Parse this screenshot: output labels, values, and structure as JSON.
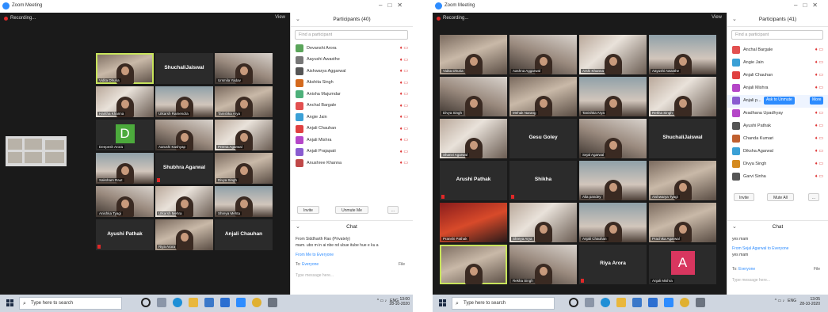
{
  "left": {
    "title": "Zoom Meeting",
    "recording": "Recording...",
    "view_label": "View",
    "panel_title": "Participants (40)",
    "search_placeholder": "Find a participant",
    "participants": [
      {
        "name": "Devanshi Arora",
        "color": "#5aa55a"
      },
      {
        "name": "Aayushi Awasthe",
        "color": "#777"
      },
      {
        "name": "Aishwarya Aggarwal",
        "color": "#555"
      },
      {
        "name": "Akshita Singh",
        "color": "#d46a1e"
      },
      {
        "name": "Anisha Majumdar",
        "color": "#4db07a"
      },
      {
        "name": "Anchal Bargale",
        "color": "#e25050"
      },
      {
        "name": "Angie Jain",
        "color": "#3aa0d6"
      },
      {
        "name": "Anjali Chauhan",
        "color": "#e04040"
      },
      {
        "name": "Anjali Mishra",
        "color": "#b546c8"
      },
      {
        "name": "Anjali Prajapati",
        "color": "#8a5cd0"
      },
      {
        "name": "Anushree Khanna",
        "color": "#c04848"
      }
    ],
    "btn_invite": "Invite",
    "btn_unmute": "Unmute Me",
    "btn_more": "...",
    "chat_title": "Chat",
    "chat_line1": "From Siddharth Rao  (Privately)",
    "chat_line2": "mam. ubo m in ai nbe nd ubue itube hue e ku a",
    "chat_from": "From Me to Everyone",
    "to_label": "To:",
    "to_value": "Everyone",
    "file_label": "File",
    "chat_placeholder": "Type message here...",
    "tiles": [
      {
        "label": "Vidita Dhuria"
      },
      {
        "label": "Utkarsh Mehra"
      },
      {
        "label": "Ursmila Yadav"
      },
      {
        "label": "Tanishka Arya"
      },
      {
        "label": "Deepesh Arora"
      },
      {
        "label": "Aarushi Kashyap"
      },
      {
        "label": "Prerna Agarwal"
      },
      {
        "label": "Saksham Raut"
      },
      {
        "label": "Divya Singh"
      },
      {
        "label": "Haritha Khanna"
      },
      {
        "label": "Anishka Tyagi"
      },
      {
        "label": "Shreya Mehta"
      },
      {
        "label": "Riya Arora"
      }
    ],
    "names": {
      "a": "Utkarsh Ramendra",
      "c": "ShuchaliJaiswal",
      "d": "Shubhra Agarwal",
      "e": "Ayushi Pathak",
      "f": "Anjali Chauhan"
    },
    "avatar_letter": "D",
    "taskbar_search": "Type here to search",
    "tray_time": "13:00",
    "tray_date": "28-10-2020",
    "tray_lang": "ENG"
  },
  "right": {
    "title": "Zoom Meeting",
    "recording": "Recording...",
    "view_label": "View",
    "panel_title": "Participants (41)",
    "search_placeholder": "Find a participant",
    "participants": [
      {
        "name": "Anchal Bargale",
        "color": "#e25050"
      },
      {
        "name": "Angie Jain",
        "color": "#3aa0d6"
      },
      {
        "name": "Anjali Chauhan",
        "color": "#e04040"
      },
      {
        "name": "Anjali Mishra",
        "color": "#b546c8"
      },
      {
        "name": "Anjali p...",
        "color": "#8a5cd0"
      },
      {
        "name": "Aradhana Upadhyay",
        "color": "#b546c8"
      },
      {
        "name": "Ayushi Pathak",
        "color": "#555"
      },
      {
        "name": "Chanda Kumari",
        "color": "#c06030"
      },
      {
        "name": "Diksha Agarwal",
        "color": "#3aa0d6"
      },
      {
        "name": "Divya Singh",
        "color": "#d48a1e"
      },
      {
        "name": "Garvi Sinha",
        "color": "#555"
      }
    ],
    "ask_unmute": "Ask to Unmute",
    "more_label": "More",
    "btn_invite": "Invite",
    "btn_muteall": "Mute All",
    "btn_more": "...",
    "chat_title": "Chat",
    "chat_line1": "yes mam",
    "chat_from": "From Sejal Agarwal to Everyone",
    "chat_line2": "yes mam",
    "to_label": "To:",
    "to_value": "Everyone",
    "file_label": "File",
    "chat_placeholder": "Type message here...",
    "tiles": [
      {
        "label": "Vidita Dhuria"
      },
      {
        "label": "Aashna Aggarwal"
      },
      {
        "label": "Arshi Khanna"
      },
      {
        "label": "Divya Singh"
      },
      {
        "label": "Mehak Narang"
      },
      {
        "label": "Tanishka Arya"
      },
      {
        "label": "Shanvi Agarwal"
      },
      {
        "label": "Prachika Agarwal"
      },
      {
        "label": "Sejal Agarwal"
      },
      {
        "label": "Alia pandey"
      },
      {
        "label": "Aishwarya Tyagi"
      },
      {
        "label": "Pranshi Pathak"
      },
      {
        "label": "Shreya Arya"
      },
      {
        "label": "Anjali Chauhan"
      },
      {
        "label": "Aayushi Awasthe"
      },
      {
        "label": "Rekha Singh"
      },
      {
        "label": "Anjali Mishra"
      }
    ],
    "names": {
      "a": "Gesu Goley",
      "b": "ShuchaliJaiswal",
      "c": "Arushi Pathak",
      "d": "Shikha",
      "e": "Riya Arora"
    },
    "avatar_letter": "A",
    "taskbar_search": "Type here to search",
    "tray_time": "13:05",
    "tray_date": "28-10-2020",
    "tray_lang": "ENG"
  }
}
